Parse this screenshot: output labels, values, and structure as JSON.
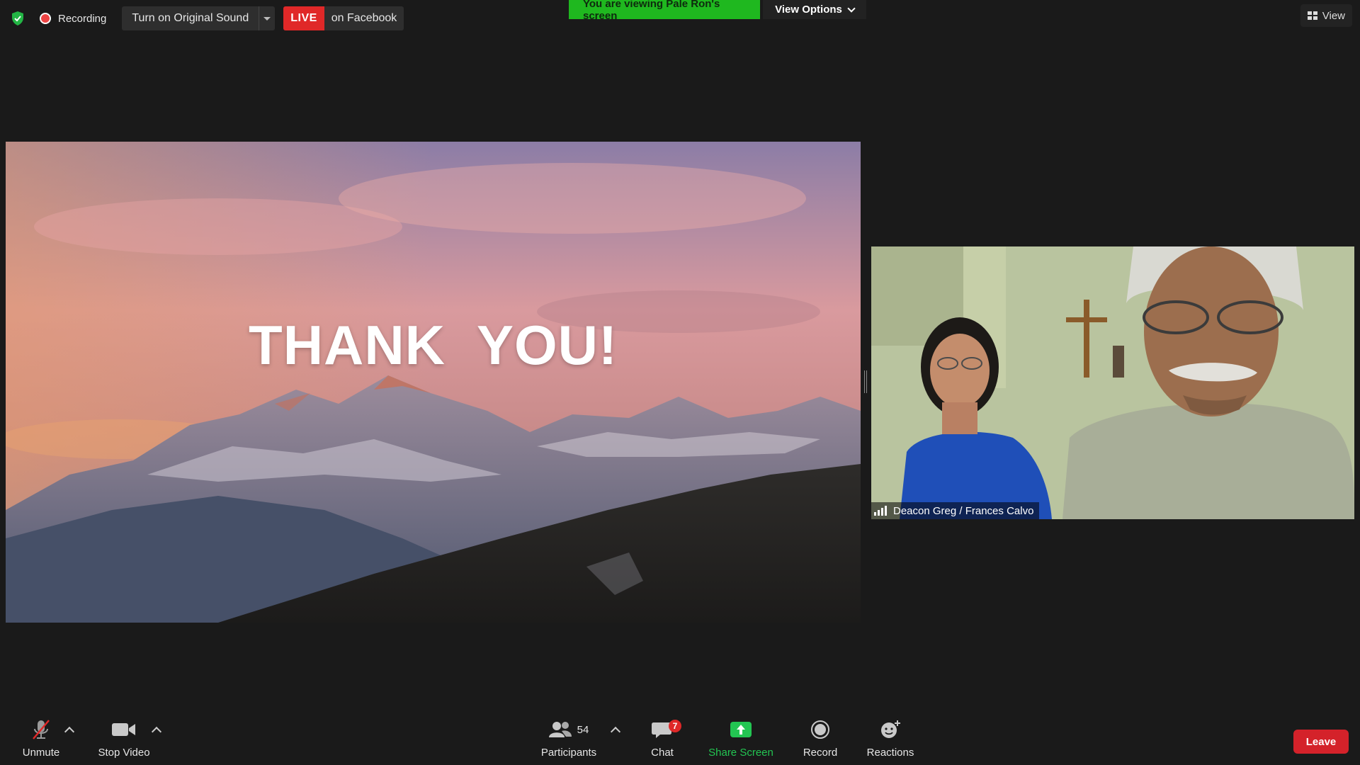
{
  "status_bar": {
    "security_icon": "shield-check-icon",
    "recording_label": "Recording",
    "original_sound_label": "Turn on Original Sound",
    "live_badge": "LIVE",
    "live_destination": "on Facebook"
  },
  "banner": {
    "viewing_text": "You are viewing Pale Ron's screen",
    "view_options_label": "View Options"
  },
  "view_button": {
    "label": "View"
  },
  "shared_content": {
    "slide_text": "THANK  YOU!"
  },
  "participant_video": {
    "name": "Deacon Greg / Frances Calvo"
  },
  "toolbar": {
    "unmute_label": "Unmute",
    "stop_video_label": "Stop Video",
    "participants_label": "Participants",
    "participants_count": "54",
    "chat_label": "Chat",
    "chat_badge": "7",
    "share_screen_label": "Share Screen",
    "record_label": "Record",
    "reactions_label": "Reactions",
    "leave_label": "Leave"
  },
  "colors": {
    "background": "#1a1a1a",
    "live_red": "#e02828",
    "viewing_green": "#1fb81f",
    "share_green": "#23c552",
    "leave_red": "#d4222a"
  }
}
